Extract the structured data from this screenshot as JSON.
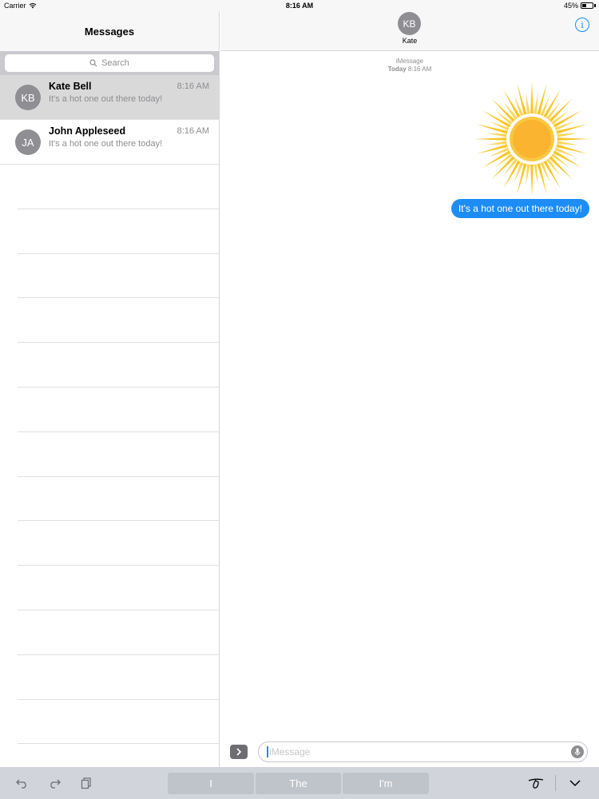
{
  "status_bar": {
    "carrier": "Carrier",
    "time": "8:16 AM",
    "battery": "45%",
    "battery_level": 0.45
  },
  "sidebar": {
    "title": "Messages",
    "search_placeholder": "Search",
    "conversations": [
      {
        "initials": "KB",
        "name": "Kate Bell",
        "time": "8:16 AM",
        "preview": "It's a hot one out there today!",
        "selected": true
      },
      {
        "initials": "JA",
        "name": "John Appleseed",
        "time": "8:16 AM",
        "preview": "It's a hot one out there today!",
        "selected": false
      }
    ]
  },
  "chat": {
    "contact_initials": "KB",
    "contact_name": "Kate",
    "info_icon": "info-icon",
    "service_label": "iMessage",
    "timestamp_day": "Today",
    "timestamp_time": "8:16 AM",
    "sticker": "sun-sticker",
    "message_text": "It's a hot one out there today!",
    "accent_color": "#1d8df5"
  },
  "composer": {
    "placeholder": "iMessage"
  },
  "keyboard_bar": {
    "suggestions": [
      "I",
      "The",
      "I'm"
    ]
  }
}
